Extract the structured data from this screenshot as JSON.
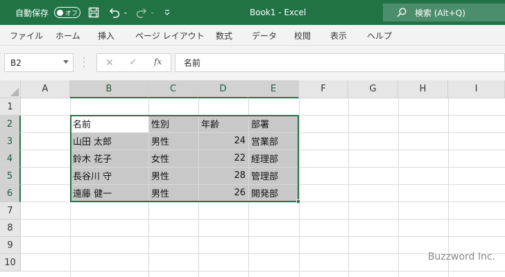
{
  "titlebar": {
    "autosave_label": "自動保存",
    "autosave_state": "オフ",
    "document_title": "Book1  -  Excel",
    "search_label": "検索 (Alt+Q)"
  },
  "ribbon": {
    "tabs": [
      "ファイル",
      "ホーム",
      "挿入",
      "ページ レイアウト",
      "数式",
      "データ",
      "校閲",
      "表示",
      "ヘルプ"
    ]
  },
  "formula_bar": {
    "name_box": "B2",
    "fx_label": "fx",
    "formula_value": "名前"
  },
  "sheet": {
    "columns": [
      "A",
      "B",
      "C",
      "D",
      "E",
      "F",
      "G",
      "H",
      "I"
    ],
    "rows": [
      "1",
      "2",
      "3",
      "4",
      "5",
      "6",
      "7",
      "8",
      "9",
      "10"
    ],
    "table": {
      "header": [
        "名前",
        "性別",
        "年齢",
        "部署"
      ],
      "rows": [
        [
          "山田 太郎",
          "男性",
          "24",
          "営業部"
        ],
        [
          "鈴木 花子",
          "女性",
          "22",
          "経理部"
        ],
        [
          "長谷川 守",
          "男性",
          "28",
          "管理部"
        ],
        [
          "遠藤 健一",
          "男性",
          "26",
          "開発部"
        ]
      ]
    }
  },
  "watermark": "Buzzword Inc.",
  "colors": {
    "brand": "#217346",
    "selection_fill": "#c8c8c8",
    "header_fill": "#e6e6e6"
  }
}
